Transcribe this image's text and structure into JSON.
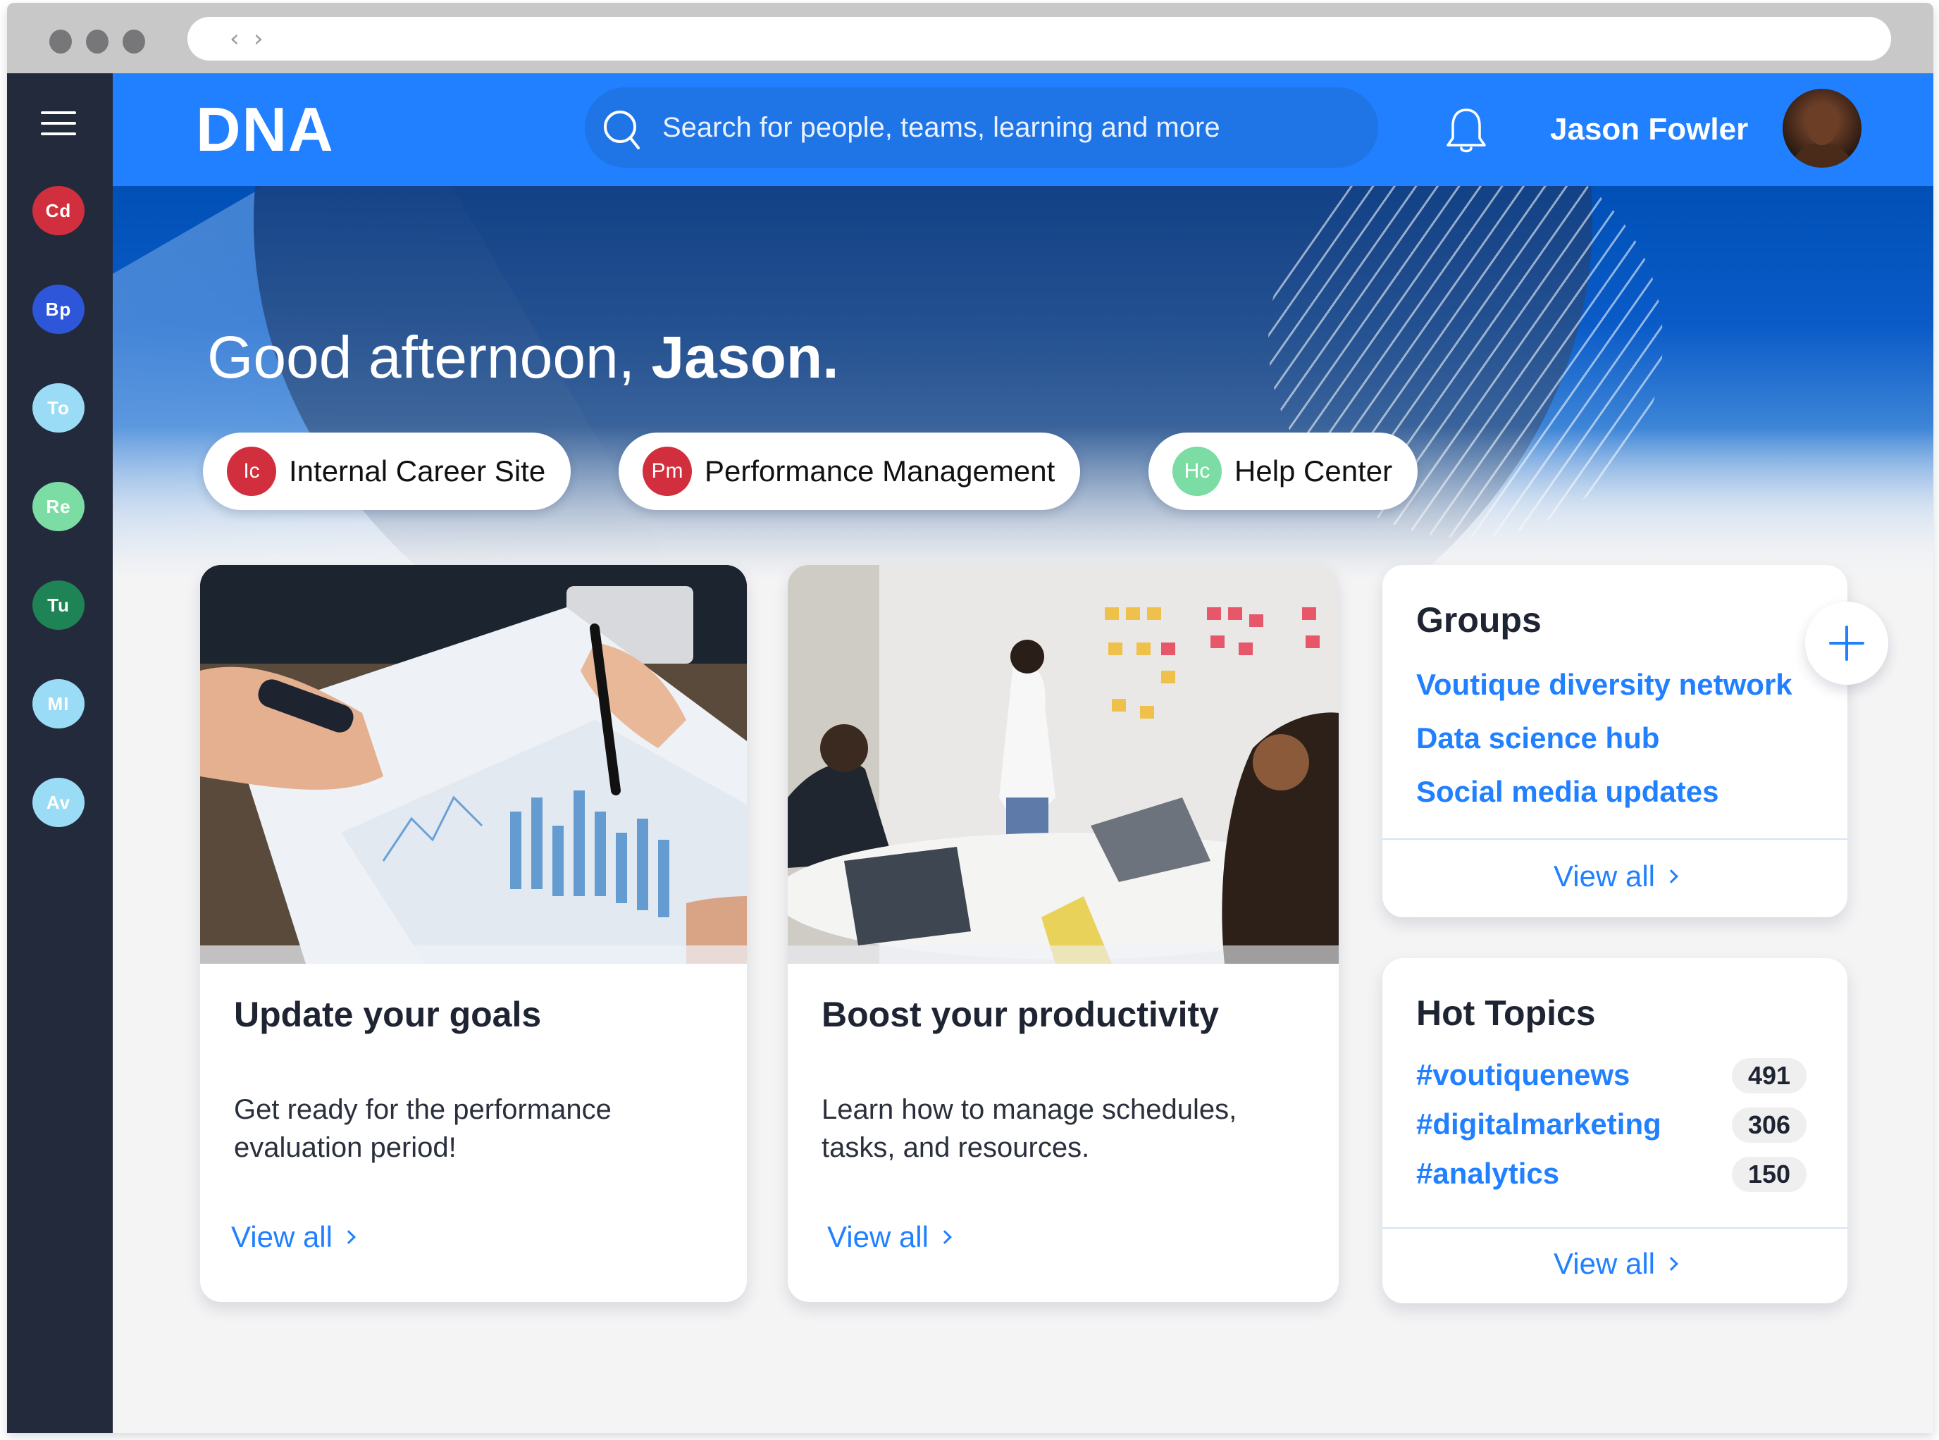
{
  "browser": {
    "nav_back": "‹",
    "nav_forward": "›"
  },
  "sidebar": {
    "menu_icon": "hamburger-menu-icon",
    "items": [
      {
        "label": "Cd",
        "color": "#d12f3d"
      },
      {
        "label": "Bp",
        "color": "#2d56d8"
      },
      {
        "label": "To",
        "color": "#9adcf5"
      },
      {
        "label": "Re",
        "color": "#7bdca4"
      },
      {
        "label": "Tu",
        "color": "#1e8456"
      },
      {
        "label": "MI",
        "color": "#9adcf5"
      },
      {
        "label": "Av",
        "color": "#9adcf5"
      }
    ]
  },
  "header": {
    "logo": "DNA",
    "search_placeholder": "Search for people, teams, learning and more",
    "search_value": "",
    "notifications_icon": "bell-icon",
    "user_name": "Jason Fowler",
    "accent_color": "#2180ff"
  },
  "hero": {
    "greeting_prefix": "Good afternoon, ",
    "greeting_name": "Jason."
  },
  "quick_links": [
    {
      "badge": "Ic",
      "label": "Internal Career Site",
      "color": "#d12f3d"
    },
    {
      "badge": "Pm",
      "label": "Performance Management",
      "color": "#d12f3d"
    },
    {
      "badge": "Hc",
      "label": "Help Center",
      "color": "#7bdca4"
    }
  ],
  "cards": [
    {
      "title": "Update your goals",
      "description": "Get ready for the performance evaluation period!",
      "link": "View all",
      "image": "hands-reviewing-charts-photo"
    },
    {
      "title": "Boost your productivity",
      "description": "Learn how to manage schedules, tasks, and resources.",
      "link": "View all",
      "image": "team-meeting-sticky-notes-photo"
    }
  ],
  "groups": {
    "title": "Groups",
    "add_icon": "plus-icon",
    "items": [
      "Voutique diversity network",
      "Data science hub",
      "Social media updates"
    ],
    "view_all": "View all"
  },
  "hot_topics": {
    "title": "Hot Topics",
    "items": [
      {
        "tag": "#voutiquenews",
        "count": "491"
      },
      {
        "tag": "#digitalmarketing",
        "count": "306"
      },
      {
        "tag": "#analytics",
        "count": "150"
      }
    ],
    "view_all": "View all"
  }
}
